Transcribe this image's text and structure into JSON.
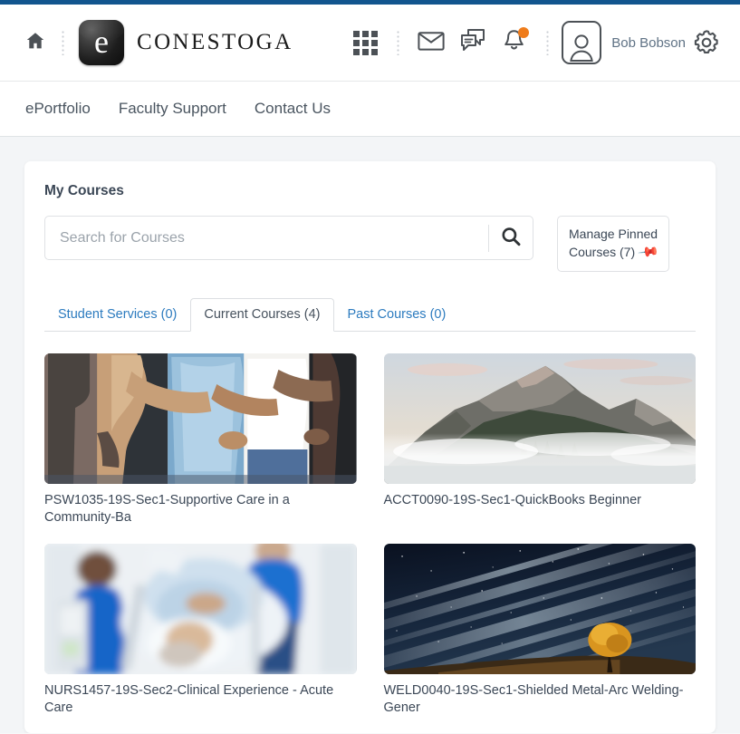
{
  "header": {
    "home_icon": "home-icon",
    "brand_letter": "e",
    "brand_word": "CONESTOGA",
    "icons": [
      {
        "name": "waffle-menu-icon",
        "label": "Course Selector"
      },
      {
        "name": "email-icon",
        "label": "Email"
      },
      {
        "name": "chat-icon",
        "label": "Subscription Alerts"
      },
      {
        "name": "bell-icon",
        "label": "Update Alerts",
        "badge": true
      }
    ],
    "user_name": "Bob Bobson",
    "settings_icon": "gear-icon"
  },
  "nav": {
    "links": [
      {
        "label": "ePortfolio"
      },
      {
        "label": "Faculty Support"
      },
      {
        "label": "Contact Us"
      }
    ]
  },
  "main": {
    "panel_title": "My Courses",
    "search": {
      "placeholder": "Search for Courses",
      "value": "",
      "icon": "search-icon"
    },
    "pin_button": {
      "line1": "Manage Pinned",
      "line2": "Courses (7)",
      "icon": "pin-icon",
      "icon_color": "#1f5fa9"
    },
    "tabs": [
      {
        "label": "Student Services (0)",
        "active": false
      },
      {
        "label": "Current Courses (4)",
        "active": true
      },
      {
        "label": "Past Courses (0)",
        "active": false
      }
    ],
    "courses": [
      {
        "title": "PSW1035-19S-Sec1-Supportive Care in a Community-Ba",
        "image": "group-of-people-embracing"
      },
      {
        "title": "ACCT0090-19S-Sec1-QuickBooks Beginner",
        "image": "foggy-mountain-landscape"
      },
      {
        "title": "NURS1457-19S-Sec2-Clinical Experience - Acute Care",
        "image": "nurses-pushing-hospital-gurney"
      },
      {
        "title": "WELD0040-19S-Sec1-Shielded Metal-Arc Welding-Gener",
        "image": "lone-tree-under-night-sky"
      }
    ]
  },
  "colors": {
    "accent_bar": "#12558e",
    "link": "#2c7bbf",
    "badge": "#ef7c1b",
    "page_bg": "#f3f5f7"
  }
}
